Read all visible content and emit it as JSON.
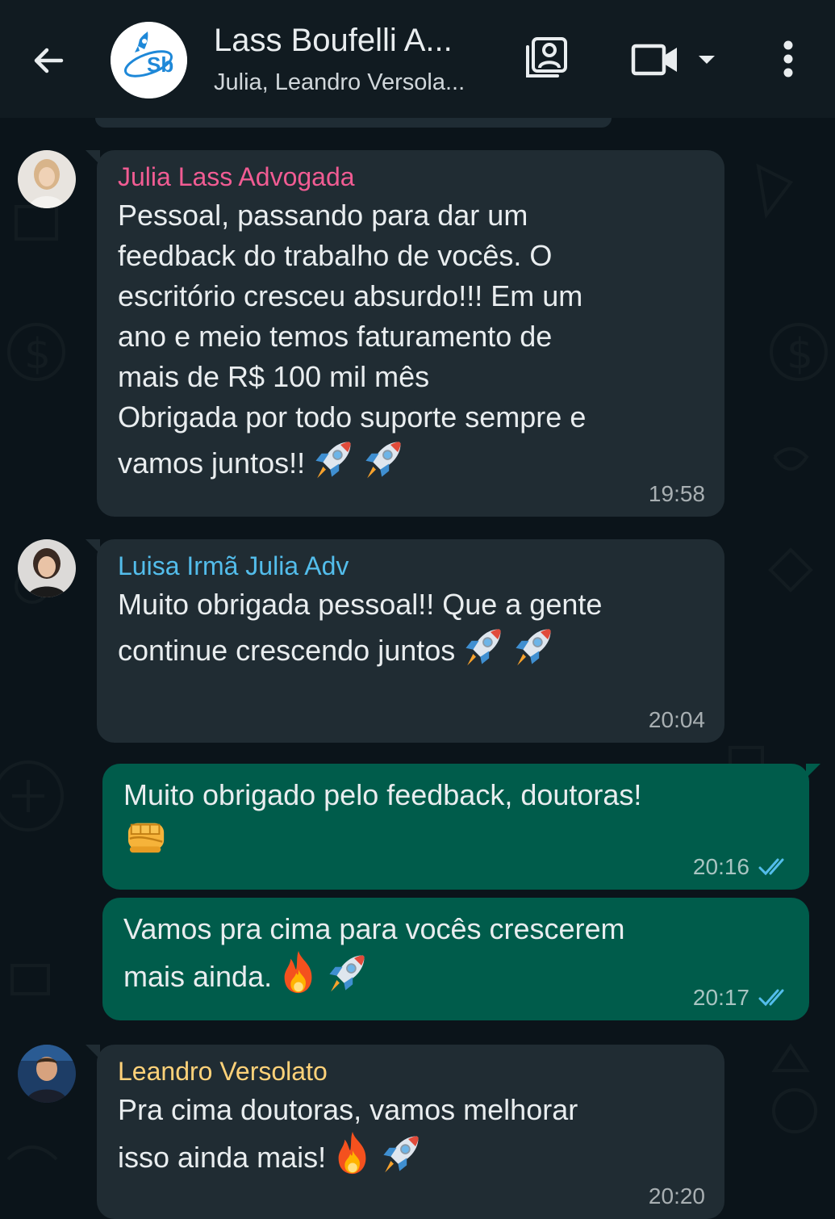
{
  "header": {
    "title": "Lass Boufelli A...",
    "subtitle": "Julia, Leandro Versola...",
    "group_avatar_text": "Sb",
    "icons": [
      "back-arrow-icon",
      "contact-card-icon",
      "video-call-icon",
      "dropdown-caret-icon",
      "more-options-icon"
    ]
  },
  "colors": {
    "header_bg": "#111b21",
    "chat_bg": "#0b141a",
    "incoming_bubble": "#202c33",
    "outgoing_bubble": "#005c4b",
    "read_ticks": "#53bdeb",
    "sender_julia": "#f15c93",
    "sender_luisa": "#53bdeb",
    "sender_leandro": "#ffd279"
  },
  "messages": [
    {
      "sender": "Julia Lass Advogada",
      "text": "Pessoal, passando para dar um\nfeedback do trabalho de vocês. O\nescritório cresceu absurdo!!! Em um\nano e meio temos faturamento de\nmais de R$ 100 mil mês\nObrigada por todo suporte sempre e\nvamos juntos!!",
      "emojis": [
        "rocket",
        "rocket"
      ],
      "time": "19:58"
    },
    {
      "sender": "Luisa Irmã Julia Adv",
      "text": "Muito obrigada pessoal!! Que a gente\ncontinue crescendo juntos",
      "emojis": [
        "rocket",
        "rocket"
      ],
      "time": "20:04"
    },
    {
      "text": "Muito obrigado pelo feedback, doutoras!\n",
      "emojis": [
        "fist"
      ],
      "time": "20:16",
      "status": "read"
    },
    {
      "text": "Vamos pra cima para vocês crescerem\nmais ainda.",
      "emojis": [
        "fire",
        "rocket"
      ],
      "time": "20:17",
      "status": "read"
    },
    {
      "sender": "Leandro Versolato",
      "text": "Pra cima doutoras, vamos melhorar\nisso ainda mais!",
      "emojis": [
        "fire",
        "rocket"
      ],
      "time": "20:20"
    }
  ]
}
